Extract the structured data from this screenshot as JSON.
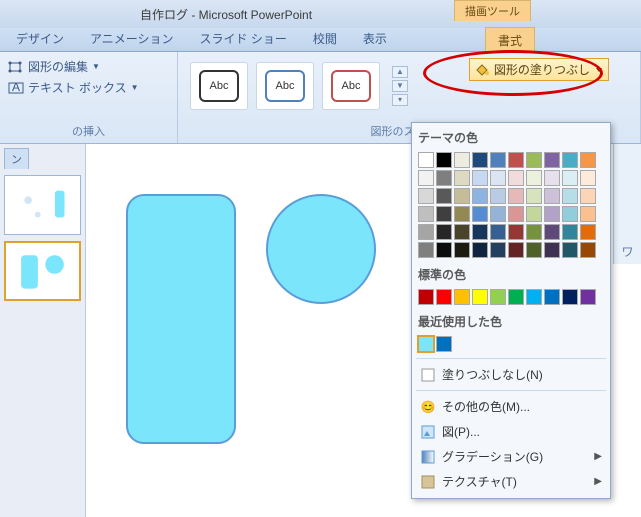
{
  "title": "自作ログ - Microsoft PowerPoint",
  "tool_tab": "描画ツール",
  "tabs": {
    "design": "デザイン",
    "animation": "アニメーション",
    "slideshow": "スライド ショー",
    "review": "校閲",
    "view": "表示",
    "format": "書式"
  },
  "groups": {
    "insert_label": "の挿入",
    "edit_shape": "図形の編集",
    "text_box": "テキスト ボックス",
    "style_label": "図形のスタイル",
    "wordart_hint": "ワ"
  },
  "style_swatches": [
    "Abc",
    "Abc",
    "Abc"
  ],
  "fill_button": "図形の塗りつぶし",
  "dropdown": {
    "theme_title": "テーマの色",
    "theme_colors": [
      [
        "#ffffff",
        "#000000",
        "#eeece1",
        "#1f497d",
        "#4f81bd",
        "#c0504d",
        "#9bbb59",
        "#8064a2",
        "#4bacc6",
        "#f79646"
      ],
      [
        "#f2f2f2",
        "#7f7f7f",
        "#ddd9c3",
        "#c6d9f0",
        "#dbe5f1",
        "#f2dcdb",
        "#ebf1dd",
        "#e5e0ec",
        "#dbeef3",
        "#fdeada"
      ],
      [
        "#d8d8d8",
        "#595959",
        "#c4bd97",
        "#8db3e2",
        "#b8cce4",
        "#e5b9b7",
        "#d7e3bc",
        "#ccc1d9",
        "#b7dde8",
        "#fbd5b5"
      ],
      [
        "#bfbfbf",
        "#3f3f3f",
        "#938953",
        "#548dd4",
        "#95b3d7",
        "#d99694",
        "#c3d69b",
        "#b2a2c7",
        "#92cddc",
        "#fac08f"
      ],
      [
        "#a5a5a5",
        "#262626",
        "#494429",
        "#17365d",
        "#366092",
        "#953734",
        "#76923c",
        "#5f497a",
        "#31859b",
        "#e36c09"
      ],
      [
        "#7f7f7f",
        "#0c0c0c",
        "#1d1b10",
        "#0f243e",
        "#244061",
        "#632423",
        "#4f6128",
        "#3f3151",
        "#205867",
        "#974806"
      ]
    ],
    "standard_title": "標準の色",
    "standard_colors": [
      "#c00000",
      "#ff0000",
      "#ffc000",
      "#ffff00",
      "#92d050",
      "#00b050",
      "#00b0f0",
      "#0070c0",
      "#002060",
      "#7030a0"
    ],
    "recent_title": "最近使用した色",
    "recent_colors": [
      "#7be5fb",
      "#0070c0"
    ],
    "no_fill": "塗りつぶしなし(N)",
    "more_colors": "その他の色(M)...",
    "picture": "図(P)...",
    "gradient": "グラデーション(G)",
    "texture": "テクスチャ(T)"
  },
  "panel_tab": "ン"
}
